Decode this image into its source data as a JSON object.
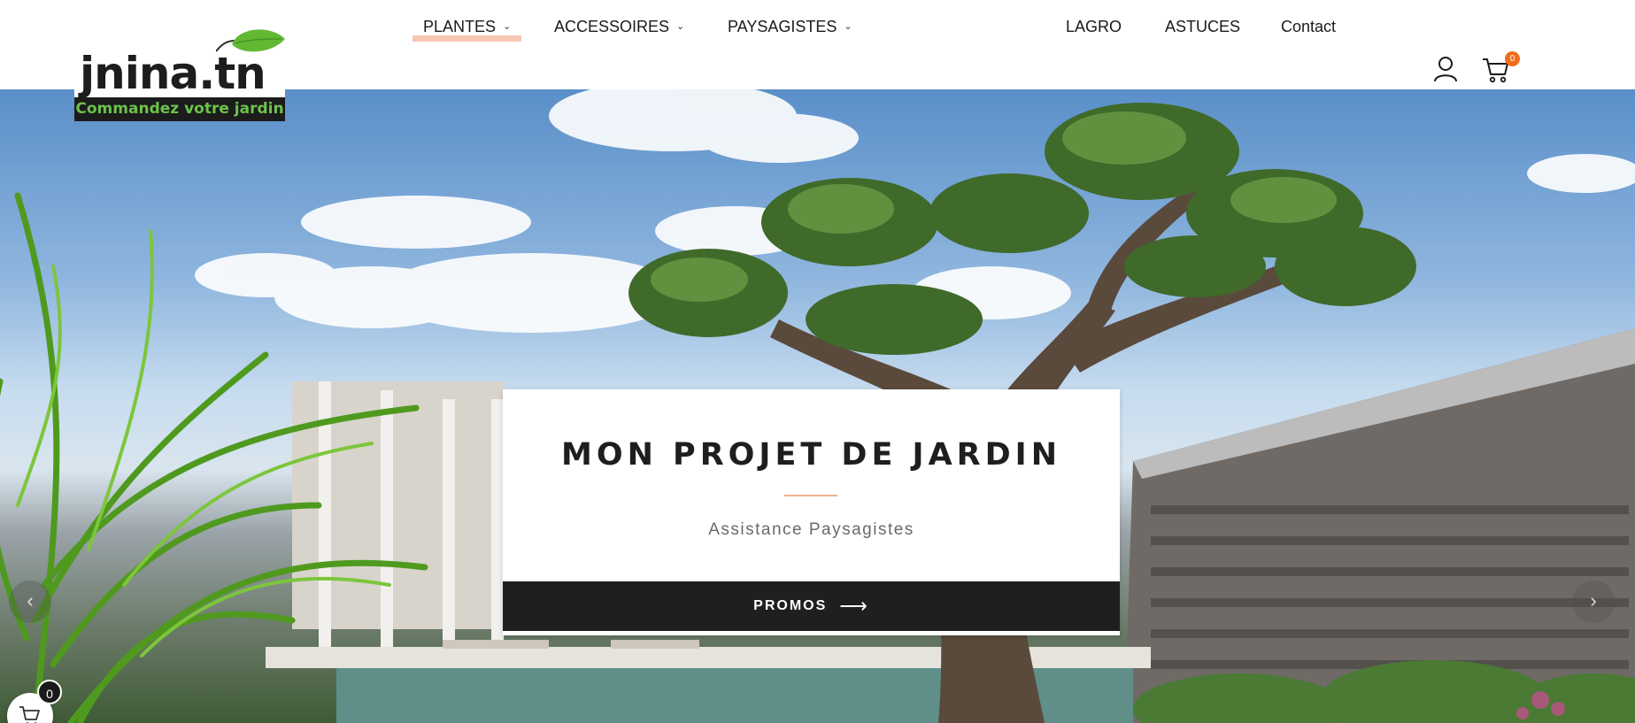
{
  "logo": {
    "brand": "jnina.tn",
    "tagline": "Commandez votre jardin"
  },
  "nav": {
    "items": [
      {
        "label": "PLANTES",
        "has_dropdown": true,
        "active": true
      },
      {
        "label": "ACCESSOIRES",
        "has_dropdown": true,
        "active": false
      },
      {
        "label": "PAYSAGISTES",
        "has_dropdown": true,
        "active": false
      },
      {
        "label": "LAGRO",
        "has_dropdown": false,
        "active": false
      },
      {
        "label": "ASTUCES",
        "has_dropdown": false,
        "active": false
      },
      {
        "label": "Contact",
        "has_dropdown": false,
        "active": false
      }
    ],
    "chevron": "⌄"
  },
  "header_icons": {
    "account_icon": "user-icon",
    "cart_icon": "cart-icon",
    "cart_count": "0"
  },
  "hero": {
    "title": "MON PROJET DE JARDIN",
    "subtitle": "Assistance Paysagistes",
    "button_label": "PROMOS",
    "button_arrow": "⟶",
    "prev_arrow": "‹",
    "next_arrow": "›"
  },
  "floating_cart": {
    "icon": "cart-icon",
    "count": "0"
  },
  "colors": {
    "accent": "#f6c7b1",
    "badge": "#f26c1b",
    "brand_green": "#6cc24a",
    "dark": "#1f1f1f"
  }
}
